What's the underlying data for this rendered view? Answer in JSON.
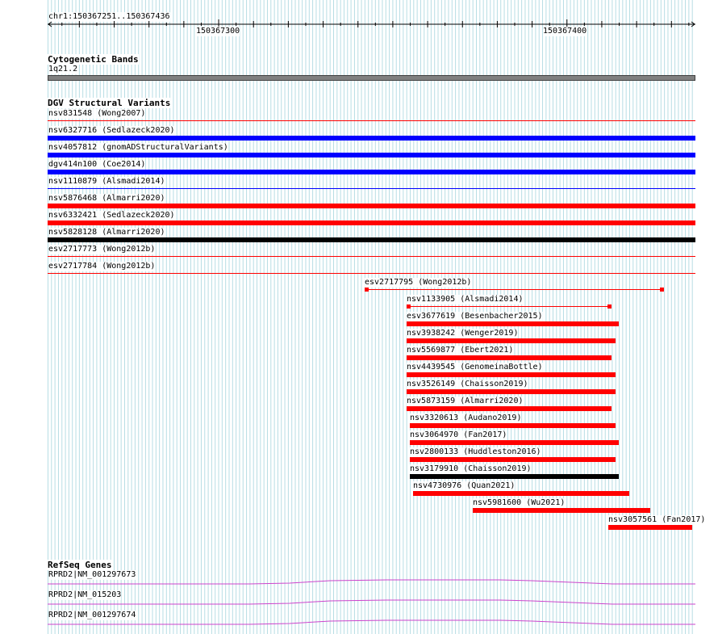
{
  "location": "chr1:150367251..150367436",
  "ruler_ticks": [
    "150367300",
    "150367400"
  ],
  "tracks": {
    "cytoband": {
      "title": "Cytogenetic Bands",
      "band": "1q21.2",
      "color": "#808080"
    },
    "dgv": {
      "title": "DGV Structural Variants",
      "colors": {
        "loss": "#ff0000",
        "gain": "#0000ff",
        "both": "#000000"
      },
      "full_rows": [
        {
          "label": "nsv831548 (Wong2007)",
          "type": "loss",
          "style": "line"
        },
        {
          "label": "nsv6327716 (Sedlazeck2020)",
          "type": "gain",
          "style": "thick"
        },
        {
          "label": "nsv4057812 (gnomADStructuralVariants)",
          "type": "gain",
          "style": "thick"
        },
        {
          "label": "dgv414n100 (Coe2014)",
          "type": "gain",
          "style": "thick"
        },
        {
          "label": "nsv1110879 (Alsmadi2014)",
          "type": "gain",
          "style": "line"
        },
        {
          "label": "nsv5876468 (Almarri2020)",
          "type": "loss",
          "style": "thick"
        },
        {
          "label": "nsv6332421 (Sedlazeck2020)",
          "type": "loss",
          "style": "thick"
        },
        {
          "label": "nsv5828128 (Almarri2020)",
          "type": "both",
          "style": "thick"
        },
        {
          "label": "esv2717773 (Wong2012b)",
          "type": "loss",
          "style": "line"
        },
        {
          "label": "esv2717784 (Wong2012b)",
          "type": "loss",
          "style": "line"
        }
      ],
      "partial_rows": [
        {
          "label": "esv2717795 (Wong2012b)",
          "type": "loss",
          "style": "line-caps",
          "start": 150367342,
          "end": 150367428
        },
        {
          "label": "nsv1133905 (Alsmadi2014)",
          "type": "loss",
          "style": "line-caps",
          "start": 150367354,
          "end": 150367413
        },
        {
          "label": "esv3677619 (Besenbacher2015)",
          "type": "loss",
          "style": "thick",
          "start": 150367354,
          "end": 150367415
        },
        {
          "label": "nsv3938242 (Wenger2019)",
          "type": "loss",
          "style": "thick",
          "start": 150367354,
          "end": 150367414
        },
        {
          "label": "nsv5569877 (Ebert2021)",
          "type": "loss",
          "style": "thick",
          "start": 150367354,
          "end": 150367413
        },
        {
          "label": "nsv4439545 (GenomeinaBottle)",
          "type": "loss",
          "style": "thick",
          "start": 150367354,
          "end": 150367414
        },
        {
          "label": "nsv3526149 (Chaisson2019)",
          "type": "loss",
          "style": "thick",
          "start": 150367354,
          "end": 150367414
        },
        {
          "label": "nsv5873159 (Almarri2020)",
          "type": "loss",
          "style": "thick",
          "start": 150367354,
          "end": 150367413
        },
        {
          "label": "nsv3320613 (Audano2019)",
          "type": "loss",
          "style": "thick",
          "start": 150367355,
          "end": 150367414
        },
        {
          "label": "nsv3064970 (Fan2017)",
          "type": "loss",
          "style": "thick",
          "start": 150367355,
          "end": 150367415
        },
        {
          "label": "nsv2800133 (Huddleston2016)",
          "type": "loss",
          "style": "thick",
          "start": 150367355,
          "end": 150367414
        },
        {
          "label": "nsv3179910 (Chaisson2019)",
          "type": "both",
          "style": "thick",
          "start": 150367355,
          "end": 150367415
        },
        {
          "label": "nsv4730976 (Quan2021)",
          "type": "loss",
          "style": "thick",
          "start": 150367356,
          "end": 150367418
        },
        {
          "label": "nsv5981600 (Wu2021)",
          "type": "loss",
          "style": "thick",
          "start": 150367373,
          "end": 150367424
        },
        {
          "label": "nsv3057561 (Fan2017)",
          "type": "loss",
          "style": "thick",
          "start": 150367412,
          "end": 150367436
        }
      ]
    },
    "refseq": {
      "title": "RefSeq Genes",
      "color": "#cc44cc",
      "genes": [
        {
          "label": "RPRD2|NM_001297673"
        },
        {
          "label": "RPRD2|NM_015203"
        },
        {
          "label": "RPRD2|NM_001297674"
        }
      ]
    }
  }
}
